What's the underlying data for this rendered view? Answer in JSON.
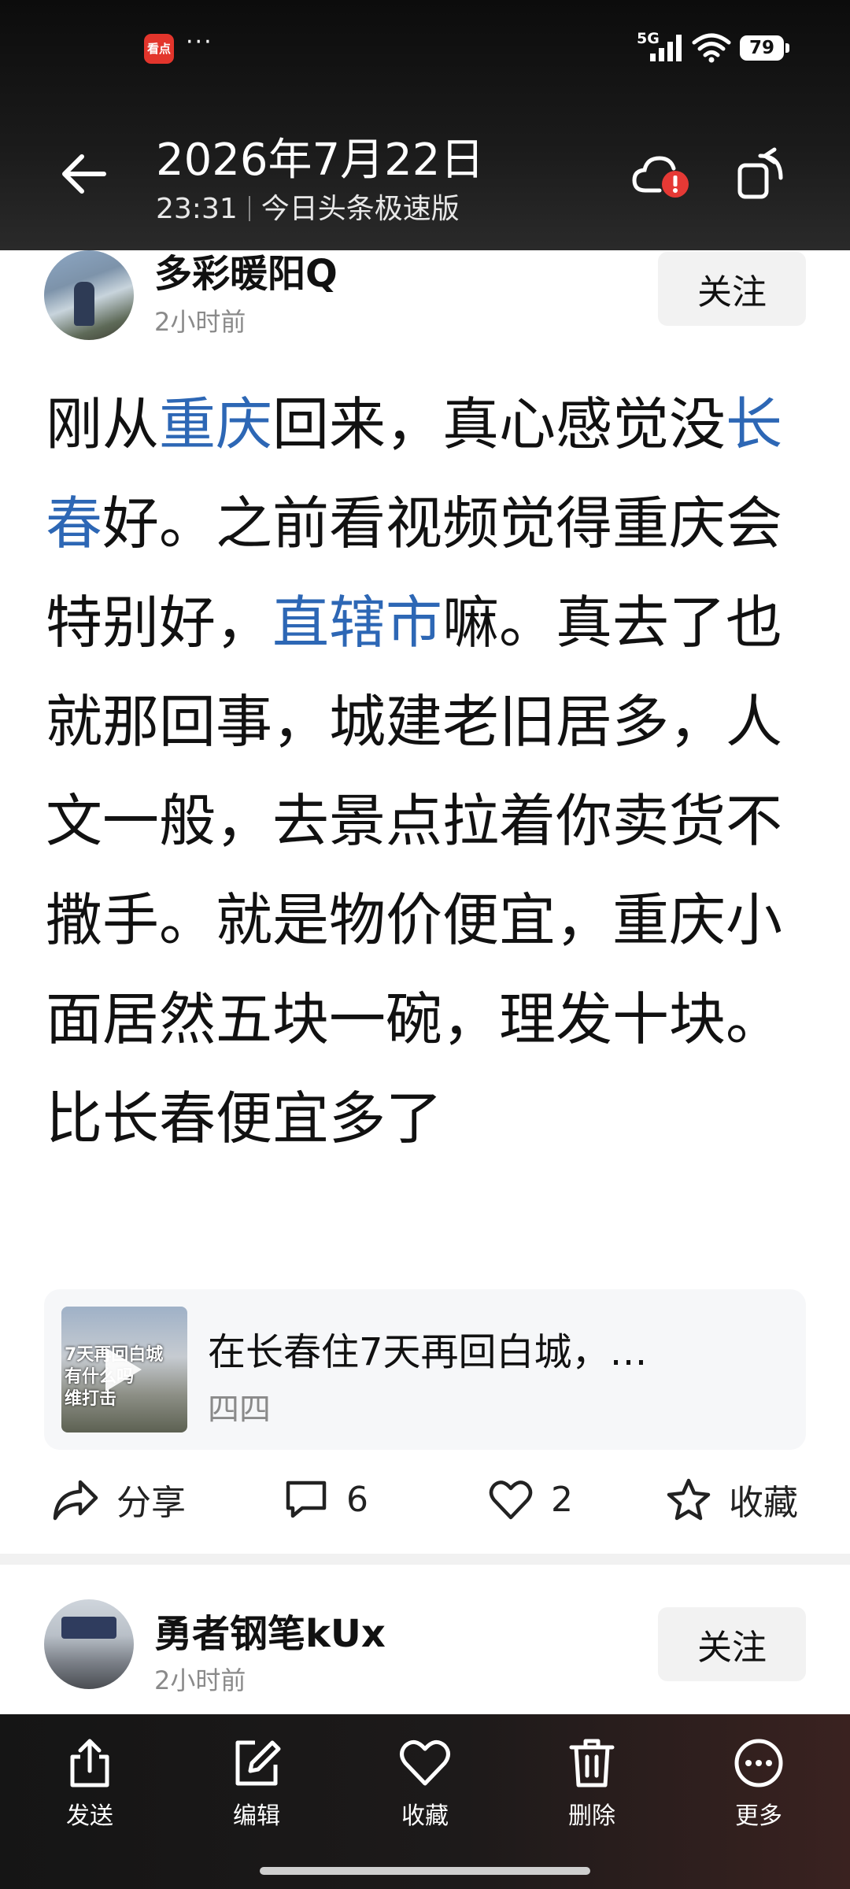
{
  "status": {
    "app_badge": "看点",
    "more_dots": "···",
    "network": "5G",
    "battery": "79"
  },
  "header": {
    "date": "2026年7月22日",
    "time": "23:31",
    "source": "今日头条极速版"
  },
  "post1": {
    "username": "多彩暖阳Q",
    "time": "2小时前",
    "follow_label": "关注",
    "body": [
      {
        "text": "刚从",
        "link": false
      },
      {
        "text": "重庆",
        "link": true
      },
      {
        "text": "回来，真心感觉没",
        "link": false
      },
      {
        "text": "长春",
        "link": true
      },
      {
        "text": "好。之前看视频觉得重庆会特别好，",
        "link": false
      },
      {
        "text": "直辖市",
        "link": true
      },
      {
        "text": "嘛。真去了也就那回事，城建老旧居多，人文一般，去景点拉着你卖货不撒手。就是物价便宜，重庆小面居然五块一碗，理发十块。比长春便宜多了",
        "link": false
      }
    ],
    "card": {
      "thumb_text": "7天再回白城\n有什么吗\n维打击",
      "title": "在长春住7天再回白城，…",
      "author": "四四"
    },
    "actions": {
      "share": "分享",
      "comments": "6",
      "likes": "2",
      "favorite": "收藏"
    }
  },
  "post2": {
    "username": "勇者钢笔kUx",
    "time": "2小时前",
    "follow_label": "关注"
  },
  "toolbar": {
    "send": "发送",
    "edit": "编辑",
    "favorite": "收藏",
    "delete": "删除",
    "more": "更多"
  }
}
